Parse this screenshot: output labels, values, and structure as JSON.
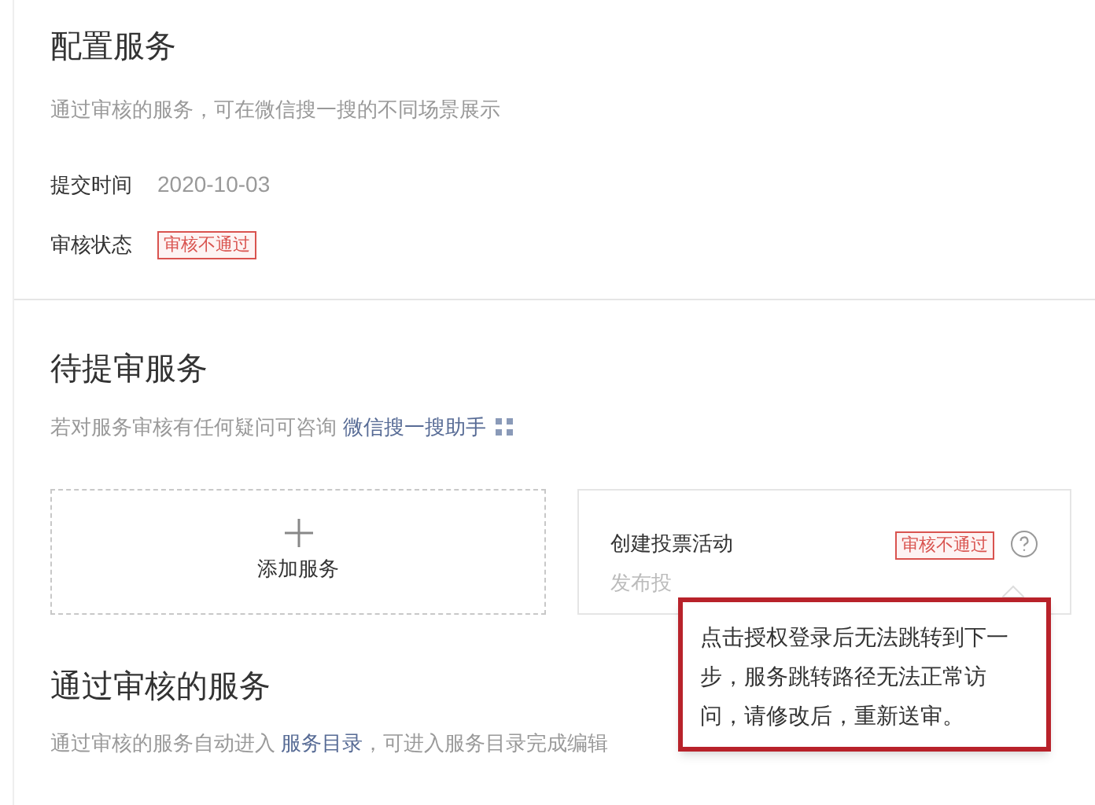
{
  "config": {
    "title": "配置服务",
    "subtitle": "通过审核的服务，可在微信搜一搜的不同场景展示",
    "fields": [
      {
        "kind": "text",
        "label": "提交时间",
        "value": "2020-10-03"
      },
      {
        "kind": "tag",
        "label": "审核状态",
        "value": "审核不通过"
      }
    ]
  },
  "pending": {
    "title": "待提审服务",
    "help_text": "若对服务审核有任何疑问可咨询",
    "help_link": "微信搜一搜助手",
    "add_label": "添加服务",
    "services": [
      {
        "name": "创建投票活动",
        "description": "发布投",
        "status": "审核不通过"
      }
    ],
    "tooltip": "点击授权登录后无法跳转到下一步，服务跳转路径无法正常访问，请修改后，重新送审。"
  },
  "approved": {
    "title": "通过审核的服务",
    "text_before": "通过审核的服务自动进入",
    "link": "服务目录",
    "text_after": "，可进入服务目录完成编辑"
  }
}
